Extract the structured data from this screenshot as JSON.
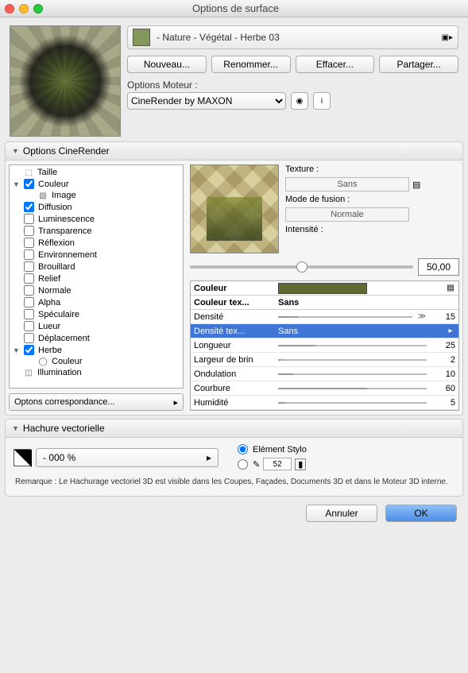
{
  "window": {
    "title": "Options de surface"
  },
  "material": {
    "path": " - Nature - Végétal - Herbe 03"
  },
  "buttons": {
    "nouveau": "Nouveau...",
    "renommer": "Renommer...",
    "effacer": "Effacer...",
    "partager": "Partager..."
  },
  "engine": {
    "label": "Options Moteur :",
    "value": "CineRender by MAXON"
  },
  "sections": {
    "cinerender": "Options CineRender",
    "hachure": "Hachure vectorielle"
  },
  "tree": {
    "taille": "Taille",
    "couleur": "Couleur",
    "image": "Image",
    "diffusion": "Diffusion",
    "luminescence": "Luminescence",
    "transparence": "Transparence",
    "reflexion": "Réflexion",
    "environnement": "Environnement",
    "brouillard": "Brouillard",
    "relief": "Relief",
    "normale": "Normale",
    "alpha": "Alpha",
    "speculaire": "Spéculaire",
    "lueur": "Lueur",
    "deplacement": "Déplacement",
    "herbe": "Herbe",
    "herbe_couleur": "Couleur",
    "illumination": "Illumination"
  },
  "correspond": "Optons correspondance...",
  "texture_panel": {
    "texture_label": "Texture :",
    "texture_value": "Sans",
    "mode_label": "Mode de fusion :",
    "mode_value": "Normale",
    "intensite_label": "Intensité :",
    "intensite_value": "50,00"
  },
  "params": {
    "couleur": {
      "label": "Couleur"
    },
    "couleur_tex": {
      "label": "Couleur tex...",
      "value": "Sans"
    },
    "densite": {
      "label": "Densité",
      "value": "15"
    },
    "densite_tex": {
      "label": "Densité tex...",
      "value": "Sans"
    },
    "longueur": {
      "label": "Longueur",
      "value": "25"
    },
    "largeur": {
      "label": "Largeur de brin",
      "value": "2"
    },
    "ondulation": {
      "label": "Ondulation",
      "value": "10"
    },
    "courbure": {
      "label": "Courbure",
      "value": "60"
    },
    "humidite": {
      "label": "Humidité",
      "value": "5"
    }
  },
  "hachure": {
    "fill_label": " - 000 %",
    "element_stylo": "Elément Stylo",
    "pen_value": "52"
  },
  "remark": "Remarque : Le Hachurage vectoriel 3D est visible dans les Coupes, Façades, Documents 3D et dans le Moteur 3D interne.",
  "footer": {
    "annuler": "Annuler",
    "ok": "OK"
  }
}
